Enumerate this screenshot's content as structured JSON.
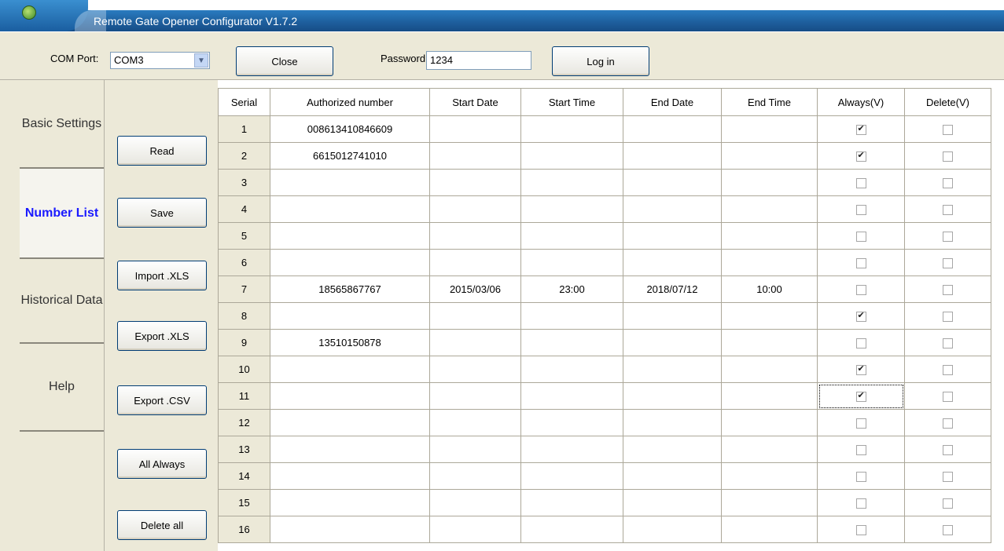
{
  "window": {
    "title": "Remote Gate Opener Configurator V1.7.2"
  },
  "toolbar": {
    "com_label": "COM Port:",
    "com_value": "COM3",
    "close_label": "Close",
    "password_label": "Password:",
    "password_value": "1234",
    "login_label": "Log in"
  },
  "tabs": [
    {
      "label": "Basic Settings",
      "active": false
    },
    {
      "label": "Number List",
      "active": true
    },
    {
      "label": "Historical Data",
      "active": false
    },
    {
      "label": "Help",
      "active": false
    }
  ],
  "actions": [
    "Read",
    "Save",
    "Import .XLS",
    "Export .XLS",
    "Export .CSV",
    "All Always",
    "Delete all"
  ],
  "table": {
    "headers": [
      "Serial",
      "Authorized number",
      "Start Date",
      "Start Time",
      "End Date",
      "End Time",
      "Always(V)",
      "Delete(V)"
    ],
    "rows": [
      {
        "serial": "1",
        "number": "008613410846609",
        "start_date": "",
        "start_time": "",
        "end_date": "",
        "end_time": "",
        "always": true,
        "delete": false
      },
      {
        "serial": "2",
        "number": "6615012741010",
        "start_date": "",
        "start_time": "",
        "end_date": "",
        "end_time": "",
        "always": true,
        "delete": false
      },
      {
        "serial": "3",
        "number": "",
        "start_date": "",
        "start_time": "",
        "end_date": "",
        "end_time": "",
        "always": false,
        "delete": false
      },
      {
        "serial": "4",
        "number": "",
        "start_date": "",
        "start_time": "",
        "end_date": "",
        "end_time": "",
        "always": false,
        "delete": false
      },
      {
        "serial": "5",
        "number": "",
        "start_date": "",
        "start_time": "",
        "end_date": "",
        "end_time": "",
        "always": false,
        "delete": false
      },
      {
        "serial": "6",
        "number": "",
        "start_date": "",
        "start_time": "",
        "end_date": "",
        "end_time": "",
        "always": false,
        "delete": false
      },
      {
        "serial": "7",
        "number": "18565867767",
        "start_date": "2015/03/06",
        "start_time": "23:00",
        "end_date": "2018/07/12",
        "end_time": "10:00",
        "always": false,
        "delete": false
      },
      {
        "serial": "8",
        "number": "",
        "start_date": "",
        "start_time": "",
        "end_date": "",
        "end_time": "",
        "always": true,
        "delete": false
      },
      {
        "serial": "9",
        "number": "13510150878",
        "start_date": "",
        "start_time": "",
        "end_date": "",
        "end_time": "",
        "always": false,
        "delete": false
      },
      {
        "serial": "10",
        "number": "",
        "start_date": "",
        "start_time": "",
        "end_date": "",
        "end_time": "",
        "always": true,
        "delete": false
      },
      {
        "serial": "11",
        "number": "",
        "start_date": "",
        "start_time": "",
        "end_date": "",
        "end_time": "",
        "always": true,
        "delete": false,
        "focus": true
      },
      {
        "serial": "12",
        "number": "",
        "start_date": "",
        "start_time": "",
        "end_date": "",
        "end_time": "",
        "always": false,
        "delete": false
      },
      {
        "serial": "13",
        "number": "",
        "start_date": "",
        "start_time": "",
        "end_date": "",
        "end_time": "",
        "always": false,
        "delete": false
      },
      {
        "serial": "14",
        "number": "",
        "start_date": "",
        "start_time": "",
        "end_date": "",
        "end_time": "",
        "always": false,
        "delete": false
      },
      {
        "serial": "15",
        "number": "",
        "start_date": "",
        "start_time": "",
        "end_date": "",
        "end_time": "",
        "always": false,
        "delete": false
      },
      {
        "serial": "16",
        "number": "",
        "start_date": "",
        "start_time": "",
        "end_date": "",
        "end_time": "",
        "always": false,
        "delete": false
      }
    ]
  }
}
